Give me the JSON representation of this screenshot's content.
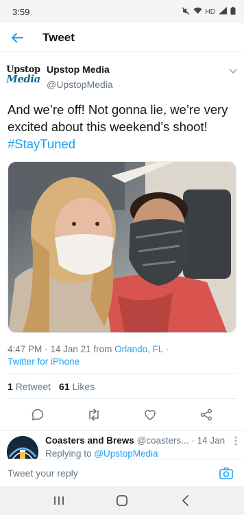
{
  "status": {
    "time": "3:59",
    "net_label": "HD",
    "icons": [
      "mute-icon",
      "wifi-icon",
      "signal-icon",
      "battery-icon"
    ]
  },
  "header": {
    "title": "Tweet",
    "back_icon": "back-arrow-icon"
  },
  "tweet": {
    "logo": {
      "top": "Upstop",
      "bottom": "Media"
    },
    "author_name": "Upstop Media",
    "author_handle": "@UpstopMedia",
    "text": "And we’re off! Not gonna lie, we’re very excited about this weekend’s shoot!",
    "hashtag": "#StayTuned",
    "time": "4:47 PM",
    "date": "14 Jan 21",
    "from_prefix": "from",
    "location": "Orlando, FL",
    "separator": "·",
    "client": "Twitter for iPhone",
    "retweets_count": "1",
    "retweets_label": "Retweet",
    "likes_count": "61",
    "likes_label": "Likes"
  },
  "actions": [
    {
      "name": "reply",
      "icon": "comment-icon"
    },
    {
      "name": "retweet",
      "icon": "retweet-icon"
    },
    {
      "name": "like",
      "icon": "heart-icon"
    },
    {
      "name": "share",
      "icon": "share-icon"
    }
  ],
  "reply": {
    "author_name": "Coasters and Brews",
    "author_handle": "@coasters...",
    "date": "14 Jan",
    "replying_prefix": "Replying to",
    "replying_to": "@UpstopMedia"
  },
  "compose": {
    "placeholder": "Tweet your reply",
    "camera_icon": "camera-icon"
  },
  "nav": {
    "icons": [
      "recents-icon",
      "home-icon",
      "back-icon"
    ]
  },
  "colors": {
    "accent": "#1da1f2",
    "text": "#14171a",
    "muted": "#657786",
    "divider": "#e6ecf0"
  }
}
